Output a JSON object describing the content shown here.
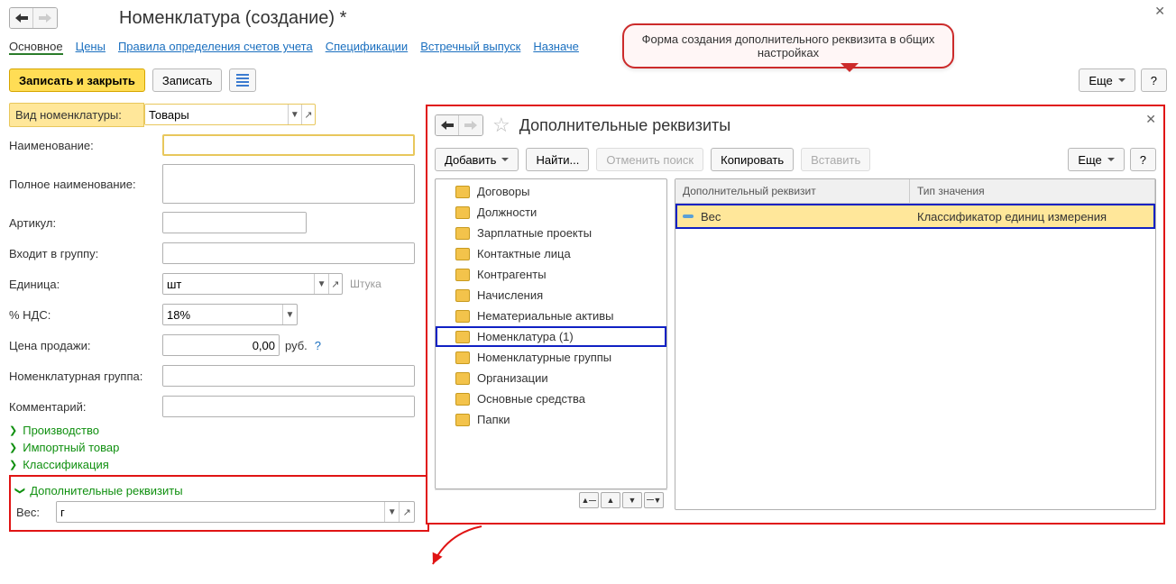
{
  "header": {
    "title": "Номенклатура (создание) *"
  },
  "tabs": {
    "active": "Основное",
    "items": [
      "Цены",
      "Правила определения счетов учета",
      "Спецификации",
      "Встречный выпуск",
      "Назначе"
    ],
    "cut": "е..."
  },
  "toolbar": {
    "save_close": "Записать и закрыть",
    "save": "Записать",
    "more": "Еще",
    "help": "?"
  },
  "callout": "Форма создания дополнительного реквизита в общих настройках",
  "form": {
    "type_label": "Вид номенклатуры:",
    "type_value": "Товары",
    "name_label": "Наименование:",
    "name_value": "",
    "fullname_label": "Полное наименование:",
    "fullname_value": "",
    "article_label": "Артикул:",
    "article_value": "",
    "group_label": "Входит в группу:",
    "group_value": "",
    "unit_label": "Единица:",
    "unit_value": "шт",
    "unit_hint": "Штука",
    "vat_label": "% НДС:",
    "vat_value": "18%",
    "price_label": "Цена продажи:",
    "price_value": "0,00",
    "price_curr": "руб.",
    "nomgroup_label": "Номенклатурная группа:",
    "nomgroup_value": "",
    "comment_label": "Комментарий:",
    "comment_value": ""
  },
  "sections": {
    "prod": "Производство",
    "import": "Импортный товар",
    "class": "Классификация",
    "extra": "Дополнительные реквизиты"
  },
  "footer": {
    "weight_label": "Вес:",
    "weight_value": "г"
  },
  "panel": {
    "title": "Дополнительные реквизиты",
    "add": "Добавить",
    "find": "Найти...",
    "cancel_find": "Отменить поиск",
    "copy": "Копировать",
    "paste": "Вставить",
    "more": "Еще",
    "help": "?",
    "tree": [
      "Договоры",
      "Должности",
      "Зарплатные проекты",
      "Контактные лица",
      "Контрагенты",
      "Начисления",
      "Нематериальные активы",
      "Номенклатура (1)",
      "Номенклатурные группы",
      "Организации",
      "Основные средства",
      "Папки"
    ],
    "tree_selected_index": 7,
    "grid": {
      "col1": "Дополнительный реквизит",
      "col2": "Тип значения",
      "row": {
        "name": "Вес",
        "type": "Классификатор единиц измерения"
      }
    }
  }
}
